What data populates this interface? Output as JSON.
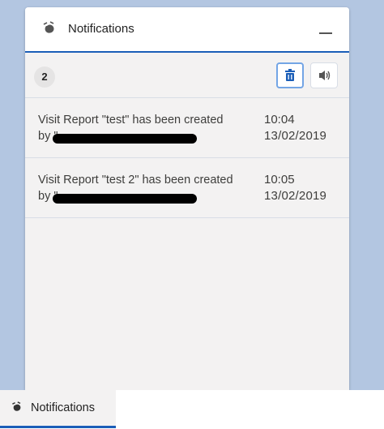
{
  "panel": {
    "title": "Notifications",
    "header_icon": "notification-bell-icon",
    "minimize_icon": "minimize-icon"
  },
  "toolbar": {
    "count": "2",
    "delete_icon": "trash-icon",
    "sound_icon": "speaker-icon"
  },
  "notifications": [
    {
      "message_line1": "Visit Report \"test\" has been created",
      "message_line2_prefix": "by \"",
      "time": "10:04",
      "date": "13/02/2019"
    },
    {
      "message_line1": "Visit Report \"test 2\" has been created",
      "message_line2_prefix": "by \"",
      "time": "10:05",
      "date": "13/02/2019"
    }
  ],
  "utility_bar": {
    "label": "Notifications",
    "icon": "notification-bell-icon"
  },
  "colors": {
    "accent": "#1b5eb8",
    "background": "#b3c6e1",
    "panel": "#f3f2f2"
  }
}
